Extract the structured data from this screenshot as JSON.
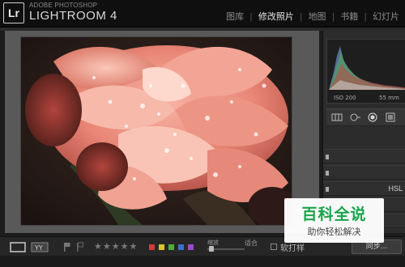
{
  "app": {
    "logo": "Lr",
    "vendor": "ADOBE PHOTOSHOP",
    "title": "LIGHTROOM 4"
  },
  "modules": [
    {
      "label": "图库",
      "active": false
    },
    {
      "label": "修改照片",
      "active": true
    },
    {
      "label": "地图",
      "active": false
    },
    {
      "label": "书籍",
      "active": false
    },
    {
      "label": "幻灯片",
      "active": false
    }
  ],
  "histogram": {
    "iso": "ISO 200",
    "focal": "55 mm"
  },
  "panels": {
    "hsl_label": "HSL"
  },
  "toolbar": {
    "stars": "★★★★★",
    "zoom_label": "缩放",
    "fit_label": "适合",
    "soft_proof_label": "软打样",
    "sync_label": "同步..."
  },
  "color_labels": [
    "#d23b3b",
    "#d8c62c",
    "#4cae3b",
    "#3a6fcf",
    "#9c48c7"
  ],
  "icons": {
    "loupe": "loupe-view-icon",
    "before_after": "before-after-icon",
    "flag": "flag-icon"
  },
  "watermark": {
    "title": "百科全说",
    "subtitle": "助你轻松解决"
  }
}
